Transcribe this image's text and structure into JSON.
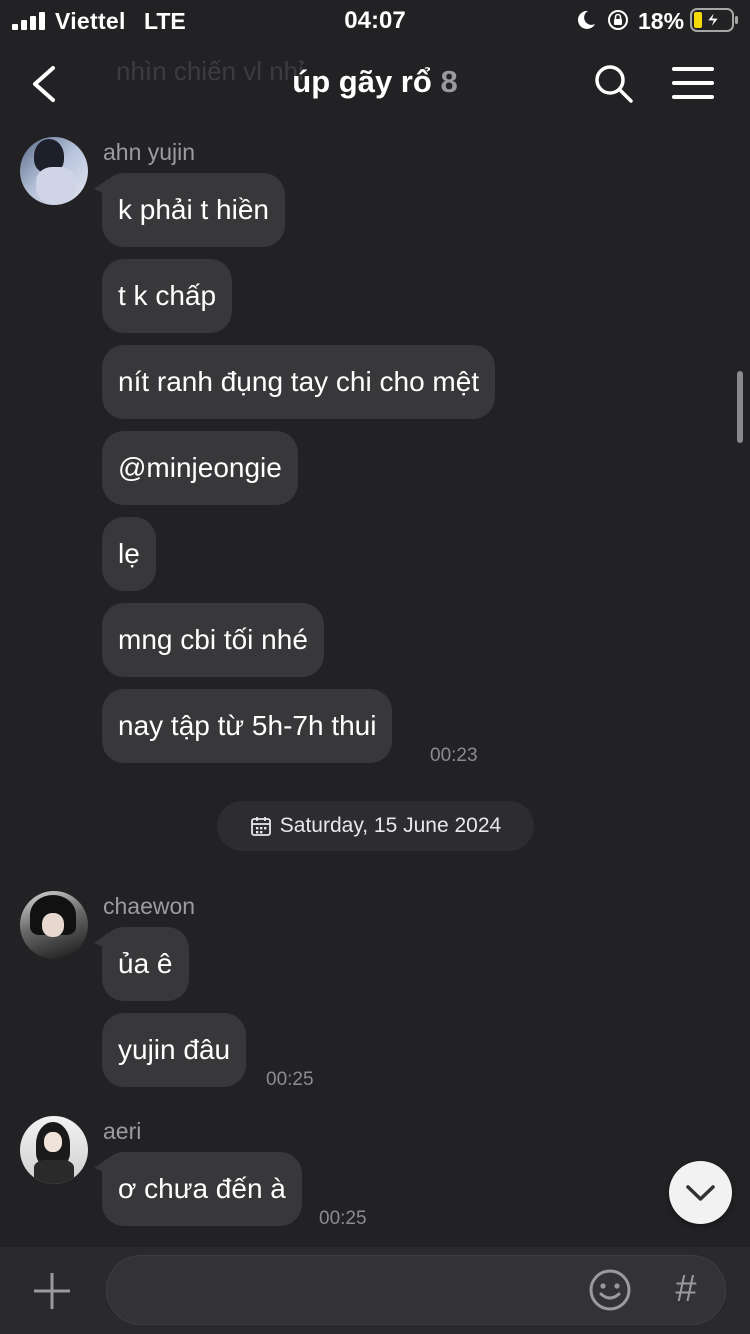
{
  "status_bar": {
    "carrier": "Viettel",
    "network": "LTE",
    "time": "04:07",
    "battery": "18%"
  },
  "header": {
    "ghost_text": "nhìn chiến vl nhỉ",
    "title": "úp gãy rổ",
    "member_count": "8"
  },
  "messages": [
    {
      "sender": "ahn yujin",
      "bubbles": [
        "k phải t hiền",
        "t k chấp",
        "nít ranh đụng tay chi cho mệt",
        "@minjeongie",
        "lẹ",
        "mng cbi tối nhé",
        "nay tập từ 5h-7h thui"
      ],
      "time": "00:23"
    },
    {
      "sender": "chaewon",
      "bubbles": [
        "ủa ê",
        "yujin đâu"
      ],
      "time": "00:25"
    },
    {
      "sender": "aeri",
      "bubbles": [
        "ơ chưa đến à"
      ],
      "time": "00:25"
    }
  ],
  "date_separator": "Saturday, 15 June 2024",
  "input": {
    "value": "",
    "placeholder": ""
  },
  "icons": {
    "back": "chevron-left-icon",
    "search": "search-icon",
    "menu": "hamburger-menu-icon",
    "calendar": "calendar-icon",
    "scroll_down": "chevron-down-icon",
    "add": "plus-icon",
    "emoji": "emoji-icon",
    "hashtag": "hashtag-icon"
  },
  "colors": {
    "background": "#222225",
    "bubble": "#38383b",
    "muted_text": "#9c9ca0",
    "input_bar": "#2a2a2d"
  }
}
